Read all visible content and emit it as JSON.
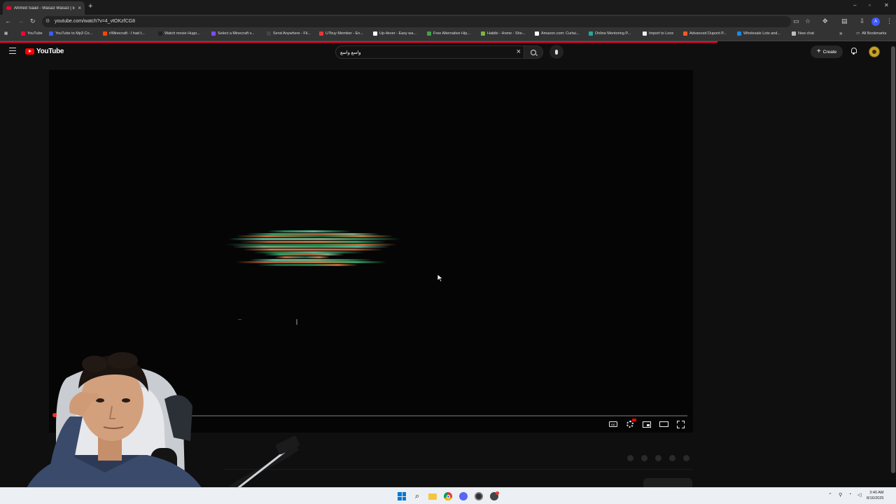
{
  "browser": {
    "tab_title": "Ahmed Saad - Wasa3 Wasa3 | E",
    "new_tab_symbol": "+",
    "close_symbol": "×",
    "url": "youtube.com/watch?v=4_vtOKzfCG8",
    "profile_initial": "A",
    "window_controls": {
      "minimize": "–",
      "maximize": "▫",
      "close": "✕"
    }
  },
  "bookmarks": {
    "items": [
      {
        "label": "YouTube",
        "color": "#ff0033"
      },
      {
        "label": "YouTube to Mp3 Co...",
        "color": "#3d5afe"
      },
      {
        "label": "r/Minecraft - I had t...",
        "color": "#ff4500"
      },
      {
        "label": "Watch movie Hugo...",
        "color": "#222222"
      },
      {
        "label": "Select a Minecraft v...",
        "color": "#7c4dff"
      },
      {
        "label": "Send Anywhere - Fil...",
        "color": "#444444"
      },
      {
        "label": "U7buy Member - En...",
        "color": "#e53935"
      },
      {
        "label": "Up-4ever - Easy wa...",
        "color": "#ffffff"
      },
      {
        "label": "Free Alternative Hip...",
        "color": "#43a047"
      },
      {
        "label": "Habibi - Home - Sho...",
        "color": "#7cb342"
      },
      {
        "label": "Amazon.com: Curtai...",
        "color": "#ffffff"
      },
      {
        "label": "Online Mentoring P...",
        "color": "#26a69a"
      },
      {
        "label": "Import to Loox",
        "color": "#eeeeee"
      },
      {
        "label": "Advanced Dupont P...",
        "color": "#ff5722"
      },
      {
        "label": "Wholesale Lots and...",
        "color": "#1e88e5"
      },
      {
        "label": "New chat",
        "color": "#bdbdbd"
      }
    ],
    "overflow": "»",
    "all_bookmarks": "All Bookmarks"
  },
  "youtube": {
    "logo_text": "YouTube",
    "search_query": "واسع واسع",
    "create_label": "Create"
  },
  "player": {
    "progress_fraction": 0.008,
    "cc_label": "CC"
  },
  "taskbar": {
    "time": "3:40 AM",
    "date": "8/16/2025"
  },
  "colors": {
    "youtube_red": "#ff0000",
    "background": "#0f0f0f",
    "taskbar": "#eceff3"
  }
}
